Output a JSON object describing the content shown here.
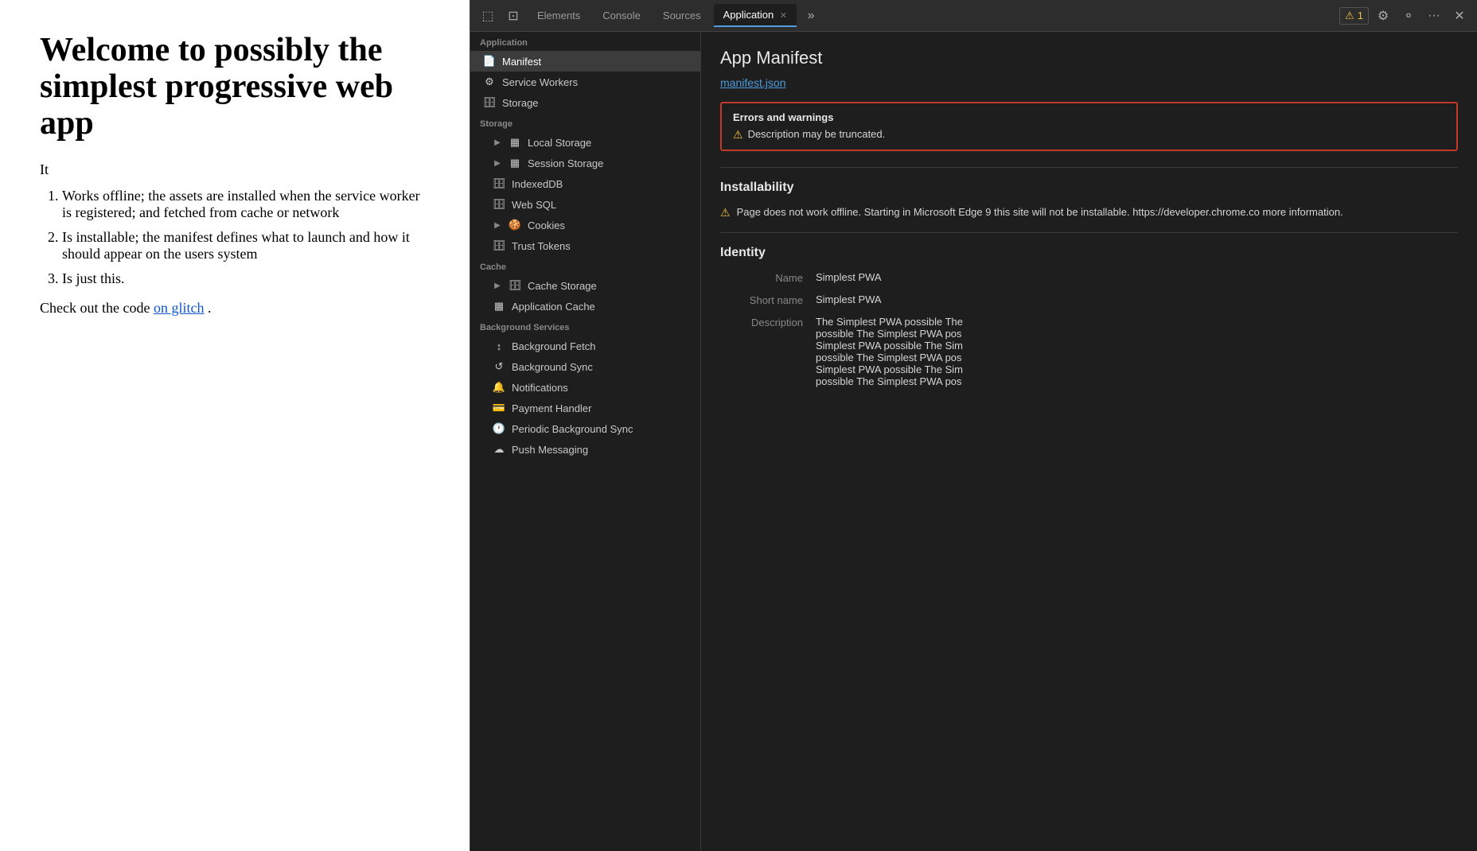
{
  "page": {
    "heading": "Welcome to possibly the simplest progressive web app",
    "intro": "It",
    "list_items": [
      "Works offline; the assets are installed when the service worker is registered; and fetched from cache or network",
      "Is installable; the manifest defines what to launch and how it should appear on the users system",
      "Is just this."
    ],
    "footer_text": "Check out the code ",
    "footer_link_text": "on glitch",
    "footer_suffix": "."
  },
  "devtools": {
    "topbar": {
      "tabs": [
        "Elements",
        "Console",
        "Sources",
        "Application"
      ],
      "active_tab": "Application",
      "warning_count": "1",
      "more_tabs_label": "»"
    },
    "sidebar": {
      "sections": [
        {
          "label": "Application",
          "items": [
            {
              "id": "manifest",
              "label": "Manifest",
              "icon": "📄",
              "active": true,
              "indented": false
            },
            {
              "id": "service-workers",
              "label": "Service Workers",
              "icon": "⚙️",
              "active": false,
              "indented": false
            },
            {
              "id": "storage",
              "label": "Storage",
              "icon": "🗄️",
              "active": false,
              "indented": false
            }
          ]
        },
        {
          "label": "Storage",
          "items": [
            {
              "id": "local-storage",
              "label": "Local Storage",
              "icon": "▶",
              "grid": true,
              "indented": true
            },
            {
              "id": "session-storage",
              "label": "Session Storage",
              "icon": "▶",
              "grid": true,
              "indented": true
            },
            {
              "id": "indexeddb",
              "label": "IndexedDB",
              "icon": "🗄️",
              "indented": true
            },
            {
              "id": "web-sql",
              "label": "Web SQL",
              "icon": "🗄️",
              "indented": true
            },
            {
              "id": "cookies",
              "label": "Cookies",
              "icon": "▶",
              "cookie": true,
              "indented": true
            },
            {
              "id": "trust-tokens",
              "label": "Trust Tokens",
              "icon": "🗄️",
              "indented": true
            }
          ]
        },
        {
          "label": "Cache",
          "items": [
            {
              "id": "cache-storage",
              "label": "Cache Storage",
              "icon": "▶",
              "cylinder": true,
              "indented": true
            },
            {
              "id": "application-cache",
              "label": "Application Cache",
              "icon": "▦",
              "indented": true
            }
          ]
        },
        {
          "label": "Background Services",
          "items": [
            {
              "id": "background-fetch",
              "label": "Background Fetch",
              "icon": "↕",
              "indented": true
            },
            {
              "id": "background-sync",
              "label": "Background Sync",
              "icon": "↺",
              "indented": true
            },
            {
              "id": "notifications",
              "label": "Notifications",
              "icon": "🔔",
              "indented": true
            },
            {
              "id": "payment-handler",
              "label": "Payment Handler",
              "icon": "💳",
              "indented": true
            },
            {
              "id": "periodic-bg-sync",
              "label": "Periodic Background Sync",
              "icon": "🕐",
              "indented": true
            },
            {
              "id": "push-messaging",
              "label": "Push Messaging",
              "icon": "☁",
              "indented": true
            }
          ]
        }
      ]
    },
    "main": {
      "title": "App Manifest",
      "manifest_link": "manifest.json",
      "errors_warnings": {
        "title": "Errors and warnings",
        "items": [
          "Description may be truncated."
        ]
      },
      "installability": {
        "title": "Installability",
        "warning": "Page does not work offline. Starting in Microsoft Edge 9 this site will not be installable. https://developer.chrome.co more information."
      },
      "identity": {
        "title": "Identity",
        "rows": [
          {
            "label": "Name",
            "value": "Simplest PWA"
          },
          {
            "label": "Short name",
            "value": "Simplest PWA"
          },
          {
            "label": "Description",
            "values": [
              "The Simplest PWA possible The",
              "possible The Simplest PWA pos",
              "Simplest PWA possible The Sim",
              "possible The Simplest PWA pos",
              "Simplest PWA possible The Sim",
              "possible The Simplest PWA pos"
            ]
          }
        ]
      }
    }
  }
}
